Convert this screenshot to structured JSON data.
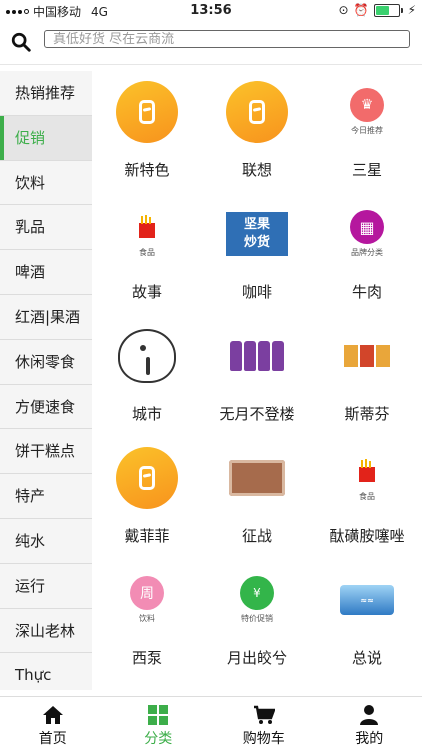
{
  "status_bar": {
    "carrier": "中国移动",
    "network": "4G",
    "time": "13:56"
  },
  "search": {
    "placeholder": "真低好货 尽在云商流"
  },
  "sidebar": {
    "items": [
      {
        "label": "热销推荐"
      },
      {
        "label": "促销",
        "active": true
      },
      {
        "label": "饮料"
      },
      {
        "label": "乳品"
      },
      {
        "label": "啤酒"
      },
      {
        "label": "红酒|果酒"
      },
      {
        "label": "休闲零食"
      },
      {
        "label": "方便速食"
      },
      {
        "label": "饼干糕点"
      },
      {
        "label": "特产"
      },
      {
        "label": "纯水"
      },
      {
        "label": "运行"
      },
      {
        "label": "深山老林"
      },
      {
        "label": "Thực"
      }
    ]
  },
  "grid": {
    "items": [
      {
        "label": "新特色",
        "icon": "orange-brand-logo"
      },
      {
        "label": "联想",
        "icon": "orange-brand-logo"
      },
      {
        "label": "三星",
        "icon": "daily-recommend-badge",
        "caption": "今日推荐"
      },
      {
        "label": "故事",
        "icon": "food-badge",
        "caption": "食品"
      },
      {
        "label": "咖啡",
        "icon": "nuts-banner",
        "banner": [
          "坚果",
          "炒货"
        ]
      },
      {
        "label": "牛肉",
        "icon": "brand-category-badge",
        "caption": "品牌分类"
      },
      {
        "label": "城市",
        "icon": "elephant-logo"
      },
      {
        "label": "无月不登楼",
        "icon": "drink-bottles-photo"
      },
      {
        "label": "斯蒂芬",
        "icon": "noodle-cups-photo"
      },
      {
        "label": "戴菲菲",
        "icon": "orange-brand-logo"
      },
      {
        "label": "征战",
        "icon": "snack-box-photo"
      },
      {
        "label": "酞磺胺噻唑",
        "icon": "food-badge",
        "caption": "食品"
      },
      {
        "label": "西泵",
        "icon": "drink-badge",
        "caption": "饮料"
      },
      {
        "label": "月出皎兮",
        "icon": "special-offer-badge",
        "caption": "特价促销"
      },
      {
        "label": "总说",
        "icon": "aquafina-logo"
      }
    ]
  },
  "tabbar": {
    "items": [
      {
        "label": "首页",
        "icon": "home-icon"
      },
      {
        "label": "分类",
        "icon": "category-icon",
        "active": true
      },
      {
        "label": "购物车",
        "icon": "cart-icon"
      },
      {
        "label": "我的",
        "icon": "user-icon"
      }
    ]
  },
  "colors": {
    "accent": "#3dae4a",
    "sidebar_bg": "#f5f5f5",
    "sidebar_active_bg": "#e5e5e5"
  }
}
